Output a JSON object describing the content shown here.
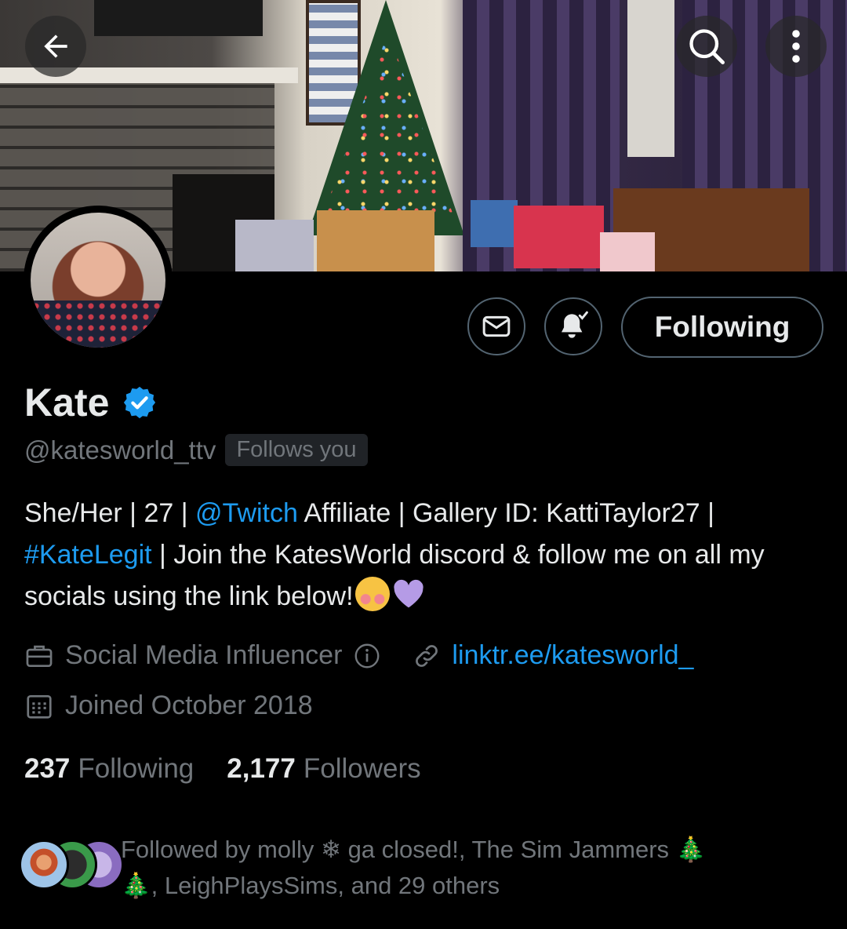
{
  "header": {
    "back_icon": "arrow-left-icon",
    "search_icon": "search-icon",
    "more_icon": "more-vertical-icon"
  },
  "actions": {
    "message_icon": "envelope-icon",
    "notify_icon": "bell-check-icon",
    "follow_label": "Following"
  },
  "profile": {
    "name": "Kate",
    "verified": true,
    "handle": "@katesworld_ttv",
    "follows_you": "Follows you",
    "bio": {
      "part1": "She/Her | 27 | ",
      "mention": "@Twitch",
      "part2": " Affiliate | Gallery ID: KattiTaylor27 | ",
      "hashtag": "#KateLegit",
      "part3": " | Join the KatesWorld discord & follow me on all my socials using the link below!"
    },
    "category": "Social Media Influencer",
    "website": "linktr.ee/katesworld_",
    "joined": "Joined October 2018"
  },
  "stats": {
    "following_count": "237",
    "following_label": "Following",
    "followers_count": "2,177",
    "followers_label": "Followers"
  },
  "followed_by": {
    "line1": "Followed by molly ❄ ga closed!, The Sim Jammers 🎄",
    "line2": "🎄, LeighPlaysSims, and 29 others"
  },
  "colors": {
    "accent": "#1d9bf0",
    "muted": "#71767b",
    "text": "#e7e9ea",
    "border": "#536471",
    "heart": "#b59be6"
  }
}
